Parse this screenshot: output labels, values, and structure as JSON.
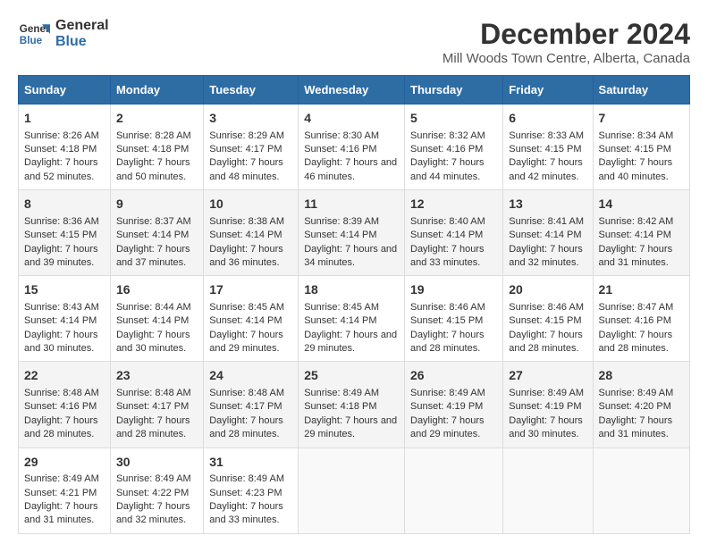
{
  "header": {
    "logo_line1": "General",
    "logo_line2": "Blue",
    "title": "December 2024",
    "subtitle": "Mill Woods Town Centre, Alberta, Canada"
  },
  "days_of_week": [
    "Sunday",
    "Monday",
    "Tuesday",
    "Wednesday",
    "Thursday",
    "Friday",
    "Saturday"
  ],
  "weeks": [
    [
      {
        "day": 1,
        "sunrise": "8:26 AM",
        "sunset": "4:18 PM",
        "daylight": "7 hours and 52 minutes."
      },
      {
        "day": 2,
        "sunrise": "8:28 AM",
        "sunset": "4:18 PM",
        "daylight": "7 hours and 50 minutes."
      },
      {
        "day": 3,
        "sunrise": "8:29 AM",
        "sunset": "4:17 PM",
        "daylight": "7 hours and 48 minutes."
      },
      {
        "day": 4,
        "sunrise": "8:30 AM",
        "sunset": "4:16 PM",
        "daylight": "7 hours and 46 minutes."
      },
      {
        "day": 5,
        "sunrise": "8:32 AM",
        "sunset": "4:16 PM",
        "daylight": "7 hours and 44 minutes."
      },
      {
        "day": 6,
        "sunrise": "8:33 AM",
        "sunset": "4:15 PM",
        "daylight": "7 hours and 42 minutes."
      },
      {
        "day": 7,
        "sunrise": "8:34 AM",
        "sunset": "4:15 PM",
        "daylight": "7 hours and 40 minutes."
      }
    ],
    [
      {
        "day": 8,
        "sunrise": "8:36 AM",
        "sunset": "4:15 PM",
        "daylight": "7 hours and 39 minutes."
      },
      {
        "day": 9,
        "sunrise": "8:37 AM",
        "sunset": "4:14 PM",
        "daylight": "7 hours and 37 minutes."
      },
      {
        "day": 10,
        "sunrise": "8:38 AM",
        "sunset": "4:14 PM",
        "daylight": "7 hours and 36 minutes."
      },
      {
        "day": 11,
        "sunrise": "8:39 AM",
        "sunset": "4:14 PM",
        "daylight": "7 hours and 34 minutes."
      },
      {
        "day": 12,
        "sunrise": "8:40 AM",
        "sunset": "4:14 PM",
        "daylight": "7 hours and 33 minutes."
      },
      {
        "day": 13,
        "sunrise": "8:41 AM",
        "sunset": "4:14 PM",
        "daylight": "7 hours and 32 minutes."
      },
      {
        "day": 14,
        "sunrise": "8:42 AM",
        "sunset": "4:14 PM",
        "daylight": "7 hours and 31 minutes."
      }
    ],
    [
      {
        "day": 15,
        "sunrise": "8:43 AM",
        "sunset": "4:14 PM",
        "daylight": "7 hours and 30 minutes."
      },
      {
        "day": 16,
        "sunrise": "8:44 AM",
        "sunset": "4:14 PM",
        "daylight": "7 hours and 30 minutes."
      },
      {
        "day": 17,
        "sunrise": "8:45 AM",
        "sunset": "4:14 PM",
        "daylight": "7 hours and 29 minutes."
      },
      {
        "day": 18,
        "sunrise": "8:45 AM",
        "sunset": "4:14 PM",
        "daylight": "7 hours and 29 minutes."
      },
      {
        "day": 19,
        "sunrise": "8:46 AM",
        "sunset": "4:15 PM",
        "daylight": "7 hours and 28 minutes."
      },
      {
        "day": 20,
        "sunrise": "8:46 AM",
        "sunset": "4:15 PM",
        "daylight": "7 hours and 28 minutes."
      },
      {
        "day": 21,
        "sunrise": "8:47 AM",
        "sunset": "4:16 PM",
        "daylight": "7 hours and 28 minutes."
      }
    ],
    [
      {
        "day": 22,
        "sunrise": "8:48 AM",
        "sunset": "4:16 PM",
        "daylight": "7 hours and 28 minutes."
      },
      {
        "day": 23,
        "sunrise": "8:48 AM",
        "sunset": "4:17 PM",
        "daylight": "7 hours and 28 minutes."
      },
      {
        "day": 24,
        "sunrise": "8:48 AM",
        "sunset": "4:17 PM",
        "daylight": "7 hours and 28 minutes."
      },
      {
        "day": 25,
        "sunrise": "8:49 AM",
        "sunset": "4:18 PM",
        "daylight": "7 hours and 29 minutes."
      },
      {
        "day": 26,
        "sunrise": "8:49 AM",
        "sunset": "4:19 PM",
        "daylight": "7 hours and 29 minutes."
      },
      {
        "day": 27,
        "sunrise": "8:49 AM",
        "sunset": "4:19 PM",
        "daylight": "7 hours and 30 minutes."
      },
      {
        "day": 28,
        "sunrise": "8:49 AM",
        "sunset": "4:20 PM",
        "daylight": "7 hours and 31 minutes."
      }
    ],
    [
      {
        "day": 29,
        "sunrise": "8:49 AM",
        "sunset": "4:21 PM",
        "daylight": "7 hours and 31 minutes."
      },
      {
        "day": 30,
        "sunrise": "8:49 AM",
        "sunset": "4:22 PM",
        "daylight": "7 hours and 32 minutes."
      },
      {
        "day": 31,
        "sunrise": "8:49 AM",
        "sunset": "4:23 PM",
        "daylight": "7 hours and 33 minutes."
      },
      null,
      null,
      null,
      null
    ]
  ]
}
